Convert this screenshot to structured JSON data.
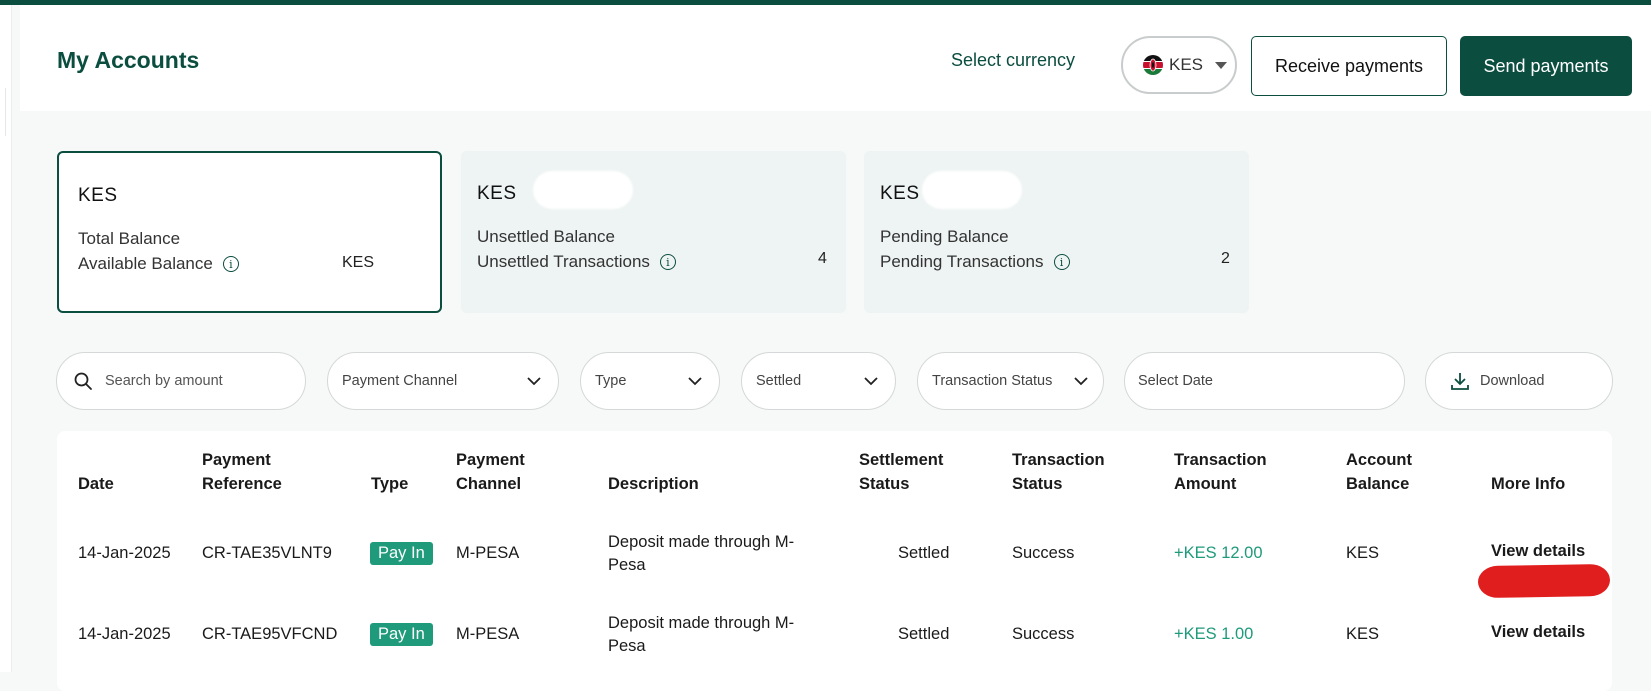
{
  "header": {
    "title": "My Accounts",
    "select_currency_label": "Select currency",
    "currency": "KES",
    "receive_label": "Receive payments",
    "send_label": "Send payments"
  },
  "cards": [
    {
      "currency": "KES",
      "line1": "Total Balance",
      "line2": "Available Balance",
      "value": "KES"
    },
    {
      "currency": "KES",
      "line1": "Unsettled Balance",
      "line2": "Unsettled Transactions",
      "value": "4"
    },
    {
      "currency": "KES",
      "line1": "Pending Balance",
      "line2": "Pending Transactions",
      "value": "2"
    }
  ],
  "filters": {
    "search_placeholder": "Search by amount",
    "payment_channel": "Payment Channel",
    "type": "Type",
    "settled": "Settled",
    "transaction_status": "Transaction Status",
    "select_date": "Select Date",
    "download": "Download"
  },
  "table": {
    "headers": {
      "date": "Date",
      "payment_reference": [
        "Payment",
        "Reference"
      ],
      "type": "Type",
      "payment_channel": [
        "Payment",
        "Channel"
      ],
      "description": "Description",
      "settlement_status": [
        "Settlement",
        "Status"
      ],
      "transaction_status": [
        "Transaction",
        "Status"
      ],
      "transaction_amount": [
        "Transaction",
        "Amount"
      ],
      "account_balance": [
        "Account",
        "Balance"
      ],
      "more_info": "More Info"
    },
    "rows": [
      {
        "date": "14-Jan-2025",
        "reference": "CR-TAE35VLNT9",
        "type": "Pay In",
        "channel": "M-PESA",
        "description": [
          "Deposit made through M-",
          "Pesa"
        ],
        "settlement": "Settled",
        "status": "Success",
        "amount": "+KES 12.00",
        "balance": "KES",
        "action": "View details"
      },
      {
        "date": "14-Jan-2025",
        "reference": "CR-TAE95VFCND",
        "type": "Pay In",
        "channel": "M-PESA",
        "description": [
          "Deposit made through M-",
          "Pesa"
        ],
        "settlement": "Settled",
        "status": "Success",
        "amount": "+KES 1.00",
        "balance": "KES",
        "action": "View details"
      }
    ]
  },
  "colors": {
    "brand": "#0b4d3f",
    "accent": "#1f9a7b",
    "redaction": "#e01e1e"
  }
}
